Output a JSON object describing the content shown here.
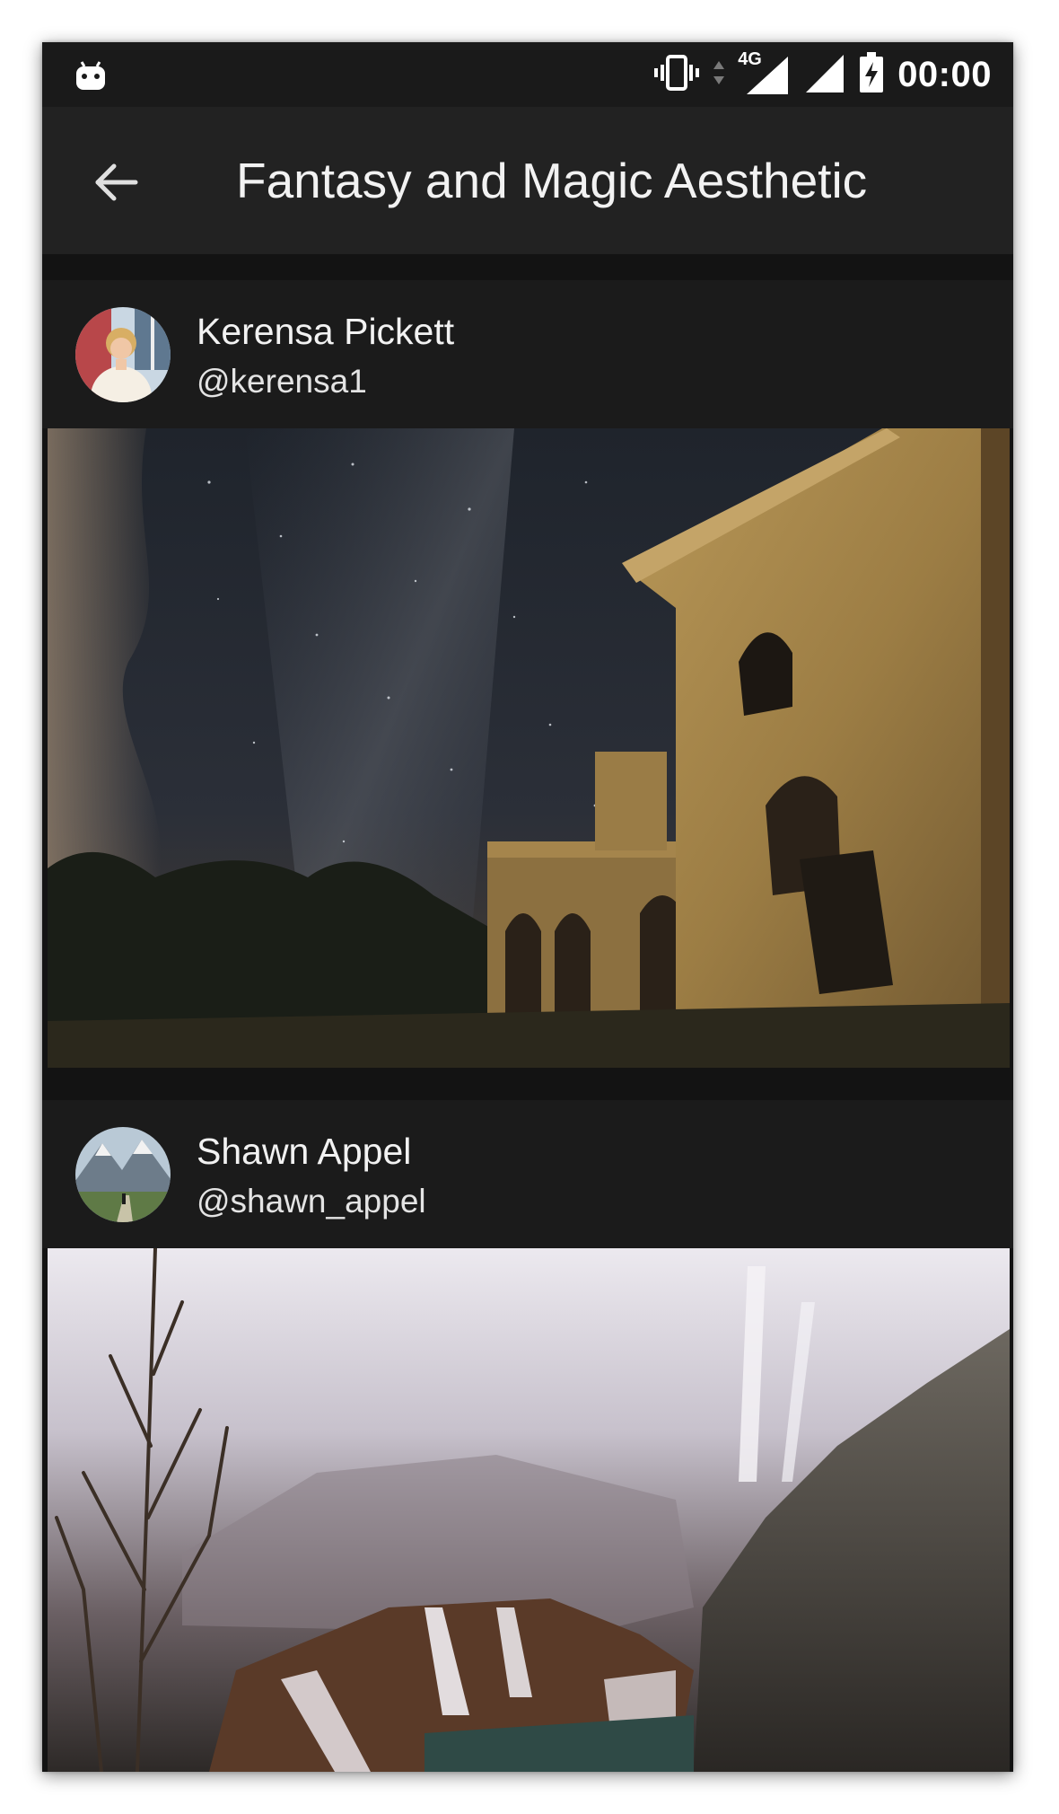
{
  "status_bar": {
    "time": "00:00",
    "network_type": "4G",
    "icons": [
      "android-icon",
      "vibrate-icon",
      "data-arrows-icon",
      "signal-4g-icon",
      "signal-icon",
      "battery-charging-icon"
    ]
  },
  "toolbar": {
    "back_icon": "arrow-left-icon",
    "title": "Fantasy and Magic Aesthetic"
  },
  "posts": [
    {
      "user_name": "Kerensa Pickett",
      "handle": "@kerensa1",
      "photo": "abandoned castle under starry night sky"
    },
    {
      "user_name": "Shawn Appel",
      "handle": "@shawn_appel",
      "photo": "misty waterfalls and cliffs"
    }
  ],
  "colors": {
    "background": "#131313",
    "status_bar": "#1a1a1a",
    "toolbar": "#222222",
    "card_header": "#1b1b1b",
    "text_primary": "#f2f2f2"
  }
}
